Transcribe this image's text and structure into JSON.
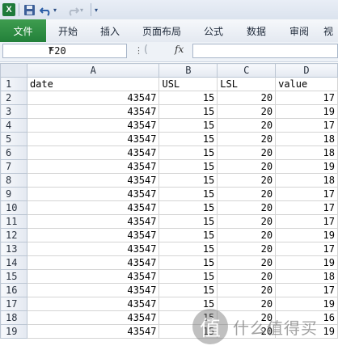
{
  "title_bar": {
    "app_icon": "excel-icon",
    "app_icon_letter": "X",
    "undo_arrow": "▾",
    "customize_arrow": "▾"
  },
  "ribbon": {
    "tabs": [
      {
        "label": "文件",
        "active": true
      },
      {
        "label": "开始"
      },
      {
        "label": "插入"
      },
      {
        "label": "页面布局"
      },
      {
        "label": "公式"
      },
      {
        "label": "数据"
      },
      {
        "label": "审阅"
      },
      {
        "label": "视"
      }
    ]
  },
  "formula_bar": {
    "name_box": "F20",
    "fx_label": "fx",
    "formula": ""
  },
  "sheet": {
    "columns": [
      "A",
      "B",
      "C",
      "D"
    ],
    "header_row": {
      "row": "1",
      "cells": [
        "date",
        "USL",
        "LSL",
        "value"
      ]
    },
    "rows": [
      {
        "row": "2",
        "cells": [
          "43547",
          "15",
          "20",
          "17"
        ]
      },
      {
        "row": "3",
        "cells": [
          "43547",
          "15",
          "20",
          "19"
        ]
      },
      {
        "row": "4",
        "cells": [
          "43547",
          "15",
          "20",
          "17"
        ]
      },
      {
        "row": "5",
        "cells": [
          "43547",
          "15",
          "20",
          "18"
        ]
      },
      {
        "row": "6",
        "cells": [
          "43547",
          "15",
          "20",
          "18"
        ]
      },
      {
        "row": "7",
        "cells": [
          "43547",
          "15",
          "20",
          "19"
        ]
      },
      {
        "row": "8",
        "cells": [
          "43547",
          "15",
          "20",
          "18"
        ]
      },
      {
        "row": "9",
        "cells": [
          "43547",
          "15",
          "20",
          "17"
        ]
      },
      {
        "row": "10",
        "cells": [
          "43547",
          "15",
          "20",
          "17"
        ]
      },
      {
        "row": "11",
        "cells": [
          "43547",
          "15",
          "20",
          "17"
        ]
      },
      {
        "row": "12",
        "cells": [
          "43547",
          "15",
          "20",
          "19"
        ]
      },
      {
        "row": "13",
        "cells": [
          "43547",
          "15",
          "20",
          "17"
        ]
      },
      {
        "row": "14",
        "cells": [
          "43547",
          "15",
          "20",
          "19"
        ]
      },
      {
        "row": "15",
        "cells": [
          "43547",
          "15",
          "20",
          "18"
        ]
      },
      {
        "row": "16",
        "cells": [
          "43547",
          "15",
          "20",
          "17"
        ]
      },
      {
        "row": "17",
        "cells": [
          "43547",
          "15",
          "20",
          "19"
        ]
      },
      {
        "row": "18",
        "cells": [
          "43547",
          "15",
          "20",
          "16"
        ]
      },
      {
        "row": "19",
        "cells": [
          "43547",
          "15",
          "20",
          "19"
        ]
      }
    ]
  },
  "watermark": {
    "icon_char": "值",
    "text": "什么值得买"
  },
  "colors": {
    "file_tab": "#23803a",
    "excel_green": "#1f7a3a",
    "header_bg": "#e4e9f1",
    "grid_line": "#d4d4d4"
  }
}
